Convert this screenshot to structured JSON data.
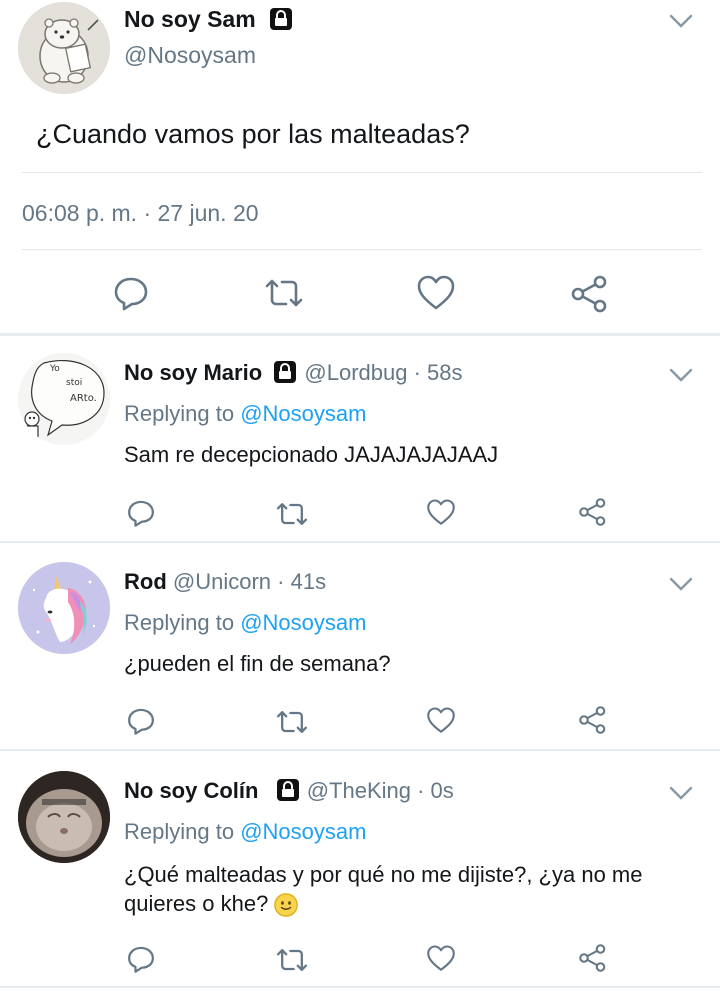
{
  "main_tweet": {
    "name": "No soy Sam",
    "handle": "@Nosoysam",
    "text": "¿Cuando vamos por las malteadas?",
    "timestamp": "06:08 p. m. · 27 jun. 20",
    "avatar_icon": "polar-bear-drawing-avatar",
    "locked": true
  },
  "replies": [
    {
      "name": "No soy Mario",
      "locked": true,
      "handle": "@Lordbug",
      "time": "· 58s",
      "replying_label": "Replying to",
      "replying_to": "@Nosoysam",
      "text": "Sam re decepcionado JAJAJAJAJAAJ",
      "avatar_icon": "sketch-speech-bubble-avatar",
      "avatar_texts": [
        "Yo",
        "stoi",
        "ARto."
      ]
    },
    {
      "name": "Rod",
      "locked": false,
      "handle": "@Unicorn",
      "time": "· 41s",
      "replying_label": "Replying to",
      "replying_to": "@Nosoysam",
      "text": "¿pueden el fin de semana?",
      "avatar_icon": "unicorn-avatar"
    },
    {
      "name": "No soy Colín",
      "locked": true,
      "handle": "@TheKing",
      "time": "· 0s",
      "replying_label": "Replying to",
      "replying_to": "@Nosoysam",
      "text_line1": "¿Qué malteadas y por qué no me dijiste?, ¿ya no me",
      "text_line2": "quieres o khe?",
      "emoji": "🙂",
      "avatar_icon": "cat-photo-avatar"
    }
  ],
  "icons": {
    "reply": "reply-icon",
    "retweet": "retweet-icon",
    "like": "heart-icon",
    "share": "share-icon",
    "more": "chevron-down-icon",
    "lock": "lock-icon"
  },
  "colors": {
    "link": "#1da1f2",
    "muted": "#657786",
    "icon": "#657786",
    "divider": "#e1e8ed"
  }
}
